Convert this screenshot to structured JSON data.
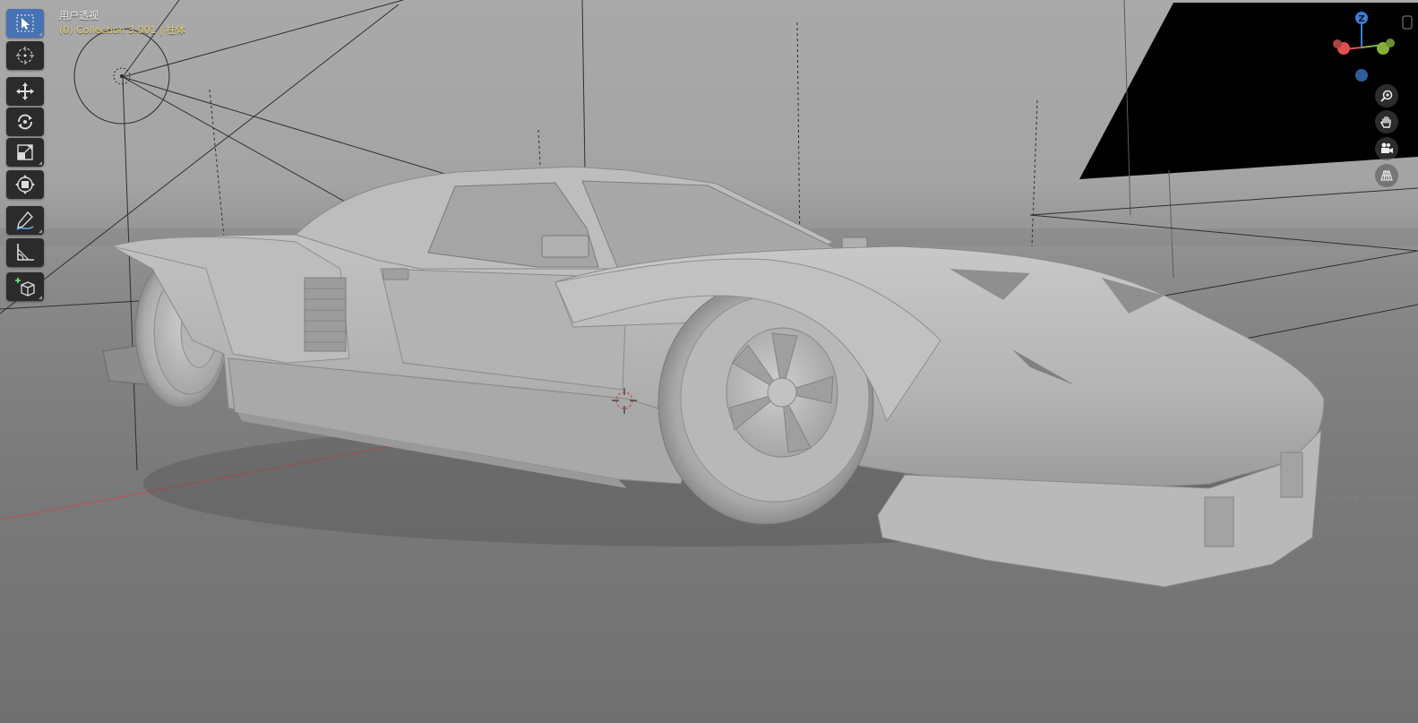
{
  "viewport": {
    "view_name": "用户透视",
    "collection_info": "(0) Collection 3.001 | 柱体"
  },
  "toolbar": {
    "tools": [
      {
        "name": "select-box",
        "active": true
      },
      {
        "name": "cursor",
        "active": false
      },
      {
        "name": "move",
        "active": false
      },
      {
        "name": "rotate",
        "active": false
      },
      {
        "name": "scale",
        "active": false
      },
      {
        "name": "transform",
        "active": false
      },
      {
        "name": "annotate",
        "active": false
      },
      {
        "name": "measure",
        "active": false
      },
      {
        "name": "add-cube",
        "active": false
      }
    ]
  },
  "gizmo": {
    "z_label": "Z",
    "axis_colors": {
      "x": "#e0504f",
      "y": "#84b03a",
      "z": "#3a7fd8"
    }
  },
  "nav_buttons": [
    "zoom-icon",
    "pan-hand-icon",
    "camera-icon",
    "grid-perspective-icon"
  ],
  "colors": {
    "active_tool": "#4772b3",
    "tool_bg": "#2b2b2b",
    "hud_subtitle": "#e8d26a",
    "x_axis_line": "#c0504f"
  }
}
